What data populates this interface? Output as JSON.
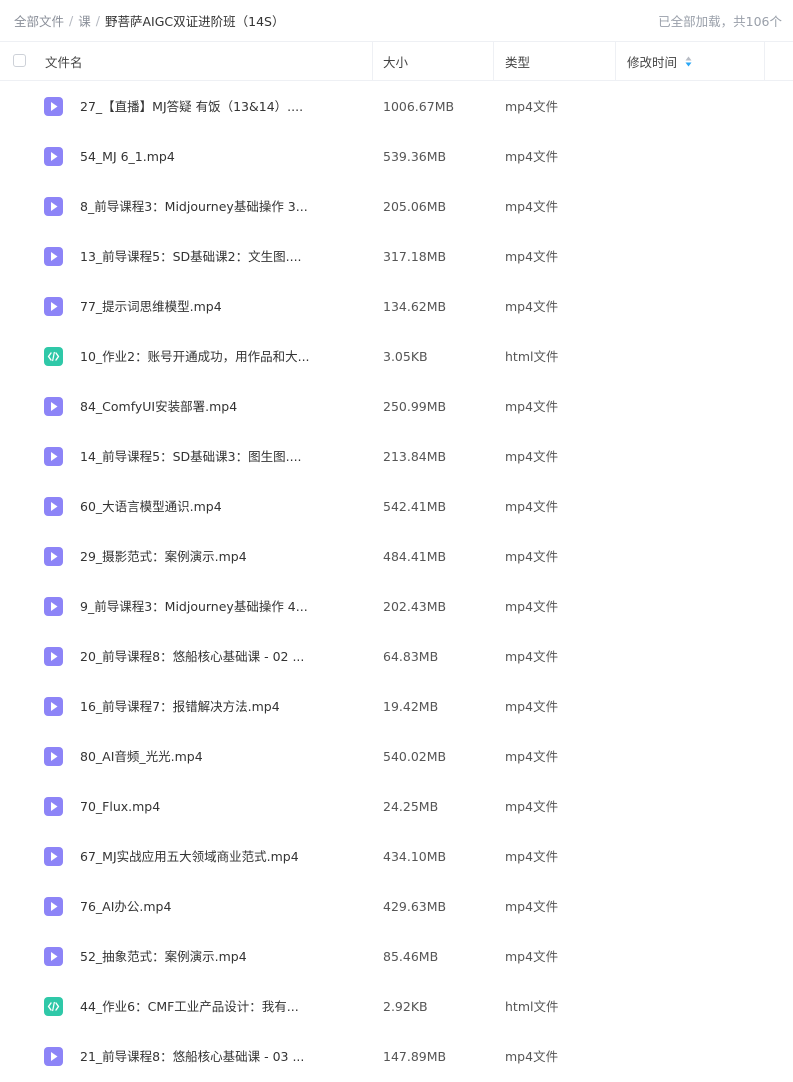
{
  "breadcrumb": {
    "items": [
      "全部文件",
      "课"
    ],
    "current": "野菩萨AIGC双证进阶班（14S）"
  },
  "status": "已全部加载，共106个",
  "columns": {
    "name": "文件名",
    "size": "大小",
    "type": "类型",
    "modified": "修改时间"
  },
  "colors": {
    "video_icon": "#8d84f7",
    "html_icon": "#2fc8a8",
    "sort_up": "#b8bcc4",
    "sort_down": "#2aa7f5"
  },
  "files": [
    {
      "name": "27_【直播】MJ答疑 有饭（13&14）....",
      "size": "1006.67MB",
      "type": "mp4文件",
      "icon": "video-file-icon"
    },
    {
      "name": "54_MJ 6_1.mp4",
      "size": "539.36MB",
      "type": "mp4文件",
      "icon": "video-file-icon"
    },
    {
      "name": "8_前导课程3：Midjourney基础操作 3...",
      "size": "205.06MB",
      "type": "mp4文件",
      "icon": "video-file-icon"
    },
    {
      "name": "13_前导课程5：SD基础课2：文生图....",
      "size": "317.18MB",
      "type": "mp4文件",
      "icon": "video-file-icon"
    },
    {
      "name": "77_提示词思维模型.mp4",
      "size": "134.62MB",
      "type": "mp4文件",
      "icon": "video-file-icon"
    },
    {
      "name": "10_作业2：账号开通成功，用作品和大...",
      "size": "3.05KB",
      "type": "html文件",
      "icon": "html-file-icon"
    },
    {
      "name": "84_ComfyUI安装部署.mp4",
      "size": "250.99MB",
      "type": "mp4文件",
      "icon": "video-file-icon"
    },
    {
      "name": "14_前导课程5：SD基础课3：图生图....",
      "size": "213.84MB",
      "type": "mp4文件",
      "icon": "video-file-icon"
    },
    {
      "name": "60_大语言模型通识.mp4",
      "size": "542.41MB",
      "type": "mp4文件",
      "icon": "video-file-icon"
    },
    {
      "name": "29_摄影范式：案例演示.mp4",
      "size": "484.41MB",
      "type": "mp4文件",
      "icon": "video-file-icon"
    },
    {
      "name": "9_前导课程3：Midjourney基础操作 4...",
      "size": "202.43MB",
      "type": "mp4文件",
      "icon": "video-file-icon"
    },
    {
      "name": "20_前导课程8：悠船核心基础课 - 02 ...",
      "size": "64.83MB",
      "type": "mp4文件",
      "icon": "video-file-icon"
    },
    {
      "name": "16_前导课程7：报错解决方法.mp4",
      "size": "19.42MB",
      "type": "mp4文件",
      "icon": "video-file-icon"
    },
    {
      "name": "80_AI音频_光光.mp4",
      "size": "540.02MB",
      "type": "mp4文件",
      "icon": "video-file-icon"
    },
    {
      "name": "70_Flux.mp4",
      "size": "24.25MB",
      "type": "mp4文件",
      "icon": "video-file-icon"
    },
    {
      "name": "67_MJ实战应用五大领域商业范式.mp4",
      "size": "434.10MB",
      "type": "mp4文件",
      "icon": "video-file-icon"
    },
    {
      "name": "76_AI办公.mp4",
      "size": "429.63MB",
      "type": "mp4文件",
      "icon": "video-file-icon"
    },
    {
      "name": "52_抽象范式：案例演示.mp4",
      "size": "85.46MB",
      "type": "mp4文件",
      "icon": "video-file-icon"
    },
    {
      "name": "44_作业6：CMF工业产品设计：我有...",
      "size": "2.92KB",
      "type": "html文件",
      "icon": "html-file-icon"
    },
    {
      "name": "21_前导课程8：悠船核心基础课 - 03 ...",
      "size": "147.89MB",
      "type": "mp4文件",
      "icon": "video-file-icon"
    }
  ]
}
